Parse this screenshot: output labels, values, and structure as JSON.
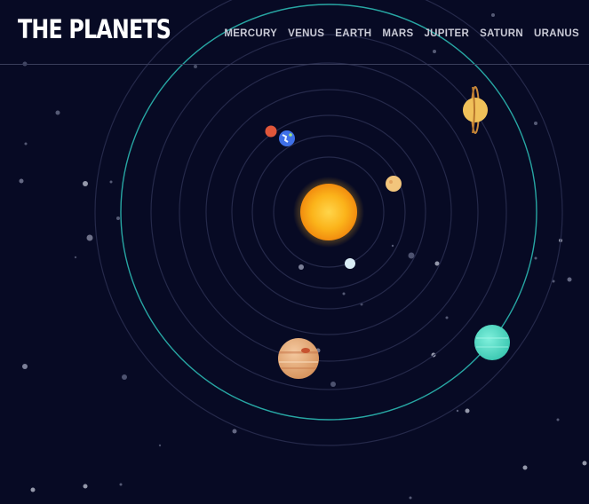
{
  "header": {
    "title": "THE PLANETS",
    "nav": [
      {
        "label": "MERCURY"
      },
      {
        "label": "VENUS"
      },
      {
        "label": "EARTH"
      },
      {
        "label": "MARS"
      },
      {
        "label": "JUPITER"
      },
      {
        "label": "SATURN"
      },
      {
        "label": "URANUS"
      }
    ]
  },
  "colors": {
    "background": "#070a24",
    "orbit": "#25294a",
    "highlight_orbit": "#2bb7b1",
    "sun": "#fbb31a",
    "mercury": "#d9ecf5",
    "venus": "#f2c57c",
    "earth": "#3e6fe8",
    "mars": "#e0563a",
    "jupiter": "#e9a97a",
    "saturn": "#f0c15a",
    "uranus": "#5ee0c9"
  },
  "icons": [
    "sun-icon",
    "mercury-icon",
    "venus-icon",
    "earth-icon",
    "mars-icon",
    "jupiter-icon",
    "saturn-icon",
    "uranus-icon"
  ]
}
